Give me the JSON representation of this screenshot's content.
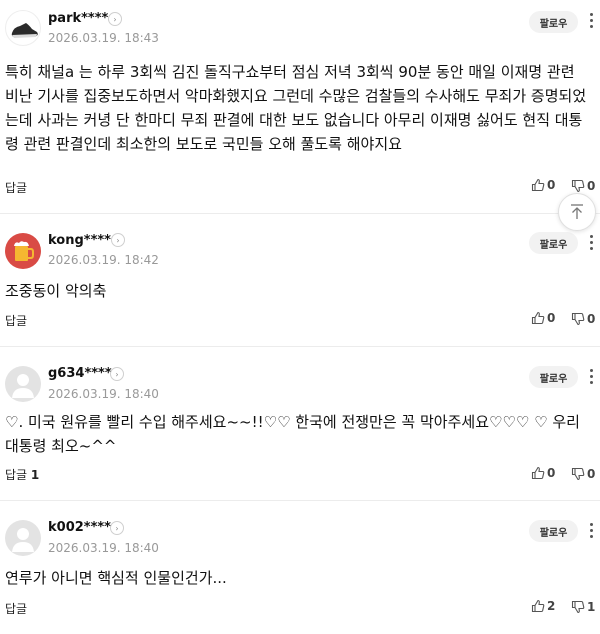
{
  "follow_label": "팔로우",
  "reply_label": "답글",
  "comments": [
    {
      "username": "park****",
      "timestamp": "2026.03.19. 18:43",
      "avatar_icon": "sneaker-icon",
      "body": "특히 채널a 는 하루 3회씩 김진 돌직구쇼부터 점심 저녁 3회씩 90분 동안 매일 이재명 관련 비난 기사를 집중보도하면서 악마화했지요 그런데 수많은 검찰들의 수사해도 무죄가 증명되었는데 사과는 커녕 단 한마디 무죄 판결에 대한 보도 없습니다 아무리 이재명 싫어도 현직 대통령 관련 판결인데 최소한의 보도로 국민들 오해 풀도록 해야지요",
      "reply_count": "",
      "likes": "0",
      "dislikes": "0"
    },
    {
      "username": "kong****",
      "timestamp": "2026.03.19. 18:42",
      "avatar_icon": "beer-icon",
      "body": "조중동이 악의축",
      "reply_count": "",
      "likes": "0",
      "dislikes": "0"
    },
    {
      "username": "g634****",
      "timestamp": "2026.03.19. 18:40",
      "avatar_icon": "default-user-icon",
      "body": "♡. 미국 원유를 빨리 수입 해주세요~~!!♡♡ 한국에 전쟁만은 꼭 막아주세요♡♡♡ ♡ 우리대통령 최오~^^",
      "reply_count": "1",
      "likes": "0",
      "dislikes": "0"
    },
    {
      "username": "k002****",
      "timestamp": "2026.03.19. 18:40",
      "avatar_icon": "default-user-icon",
      "body": "연루가 아니면 핵심적 인물인건가...",
      "reply_count": "",
      "likes": "2",
      "dislikes": "1"
    }
  ],
  "scroll_top_icon": "arrow-up-to-top-icon"
}
